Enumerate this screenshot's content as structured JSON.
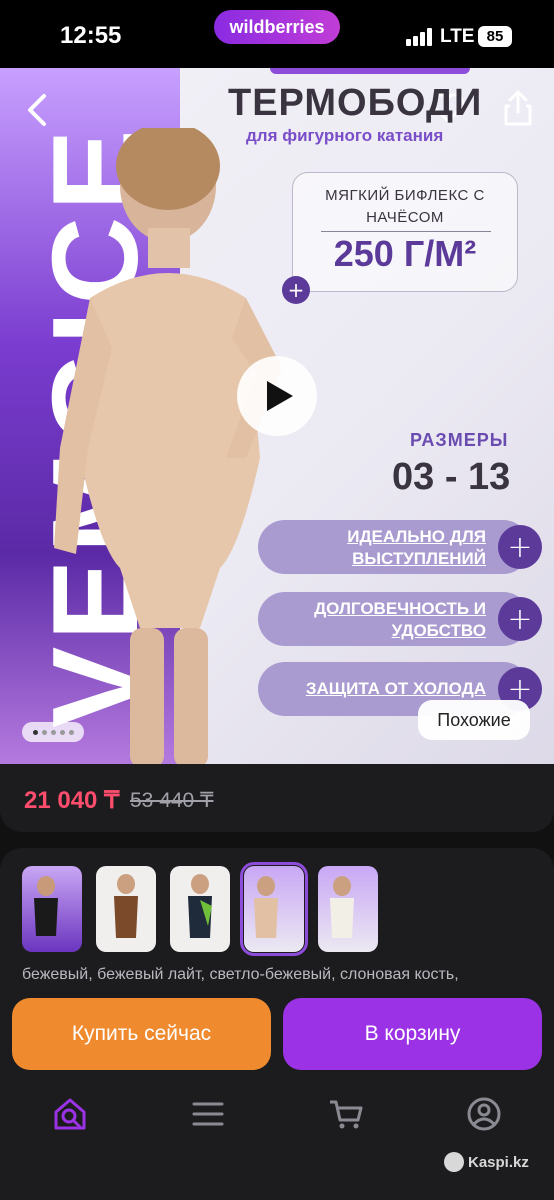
{
  "status_bar": {
    "time": "12:55",
    "brand": "wildberries",
    "network": "LTE",
    "battery": "85"
  },
  "hero": {
    "brand_vertical": "VEMGICE",
    "title": "ТЕРМОБОДИ",
    "subtitle": "для фигурного катания",
    "fabric_line1": "МЯГКИЙ БИФЛЕКС С",
    "fabric_line2": "НАЧЁСОМ",
    "fabric_value": "250 Г/М²",
    "sizes_label": "РАЗМЕРЫ",
    "sizes_value": "03 - 13",
    "features": [
      {
        "line1": "ИДЕАЛЬНО ДЛЯ",
        "line2": "ВЫСТУПЛЕНИЙ"
      },
      {
        "line1": "ДОЛГОВЕЧНОСТЬ И",
        "line2": "УДОБСТВО"
      },
      {
        "line1": "ЗАЩИТА ОТ ХОЛОДА",
        "line2": ""
      }
    ],
    "similar_label": "Похожие"
  },
  "price": {
    "current": "21 040 ₸",
    "old": "53 440 ₸"
  },
  "colors": {
    "text": "бежевый, бежевый лайт, светло-бежевый, слоновая кость,"
  },
  "actions": {
    "buy_now": "Купить сейчас",
    "add_to_cart": "В корзину"
  },
  "tabbar": {
    "items": [
      "search-home-icon",
      "menu-icon",
      "cart-icon",
      "profile-icon"
    ]
  },
  "watermark": "Kaspi.kz",
  "colors_theme": {
    "accent": "#9c32e6",
    "buy": "#ef8a2e",
    "price": "#ff4d6d"
  }
}
